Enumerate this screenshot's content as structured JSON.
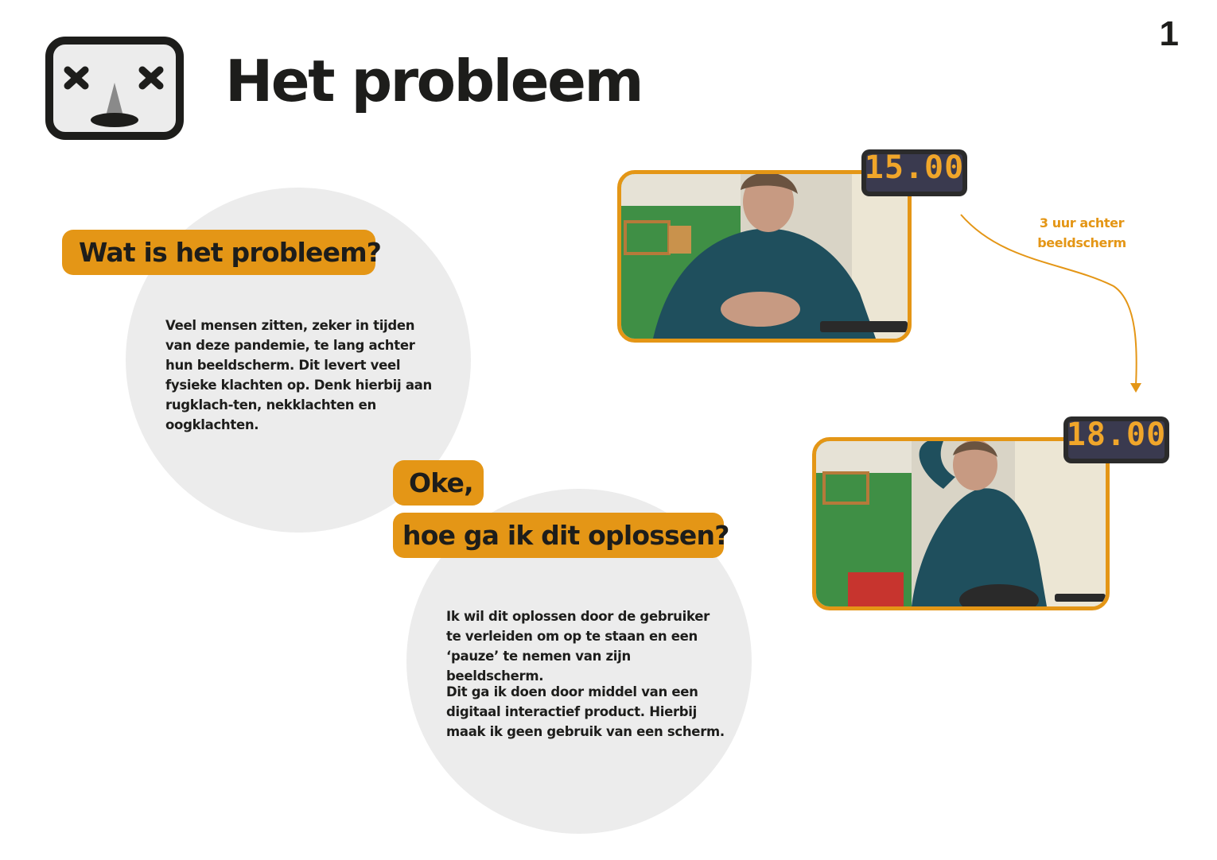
{
  "page": {
    "number": "1",
    "title": "Het probleem"
  },
  "section_problem": {
    "question": "Wat is het probleem?",
    "body": "Veel mensen zitten, zeker in tijden van deze pandemie, te lang achter hun beeldscherm. Dit levert veel fysieke klachten op. Denk hierbij aan rugklach-ten, nekklachten en oogklachten."
  },
  "section_solution": {
    "intro": "Oke,",
    "question": "hoe ga ik dit oplossen?",
    "body_1": "Ik wil dit oplossen door de gebruiker te verleiden om op te staan en een ‘pauze’ te nemen van zijn beeldscherm.",
    "body_2": "Dit ga ik doen door middel van een digitaal interactief product. Hierbij maak ik geen gebruik van een scherm."
  },
  "illustration": {
    "clock_before": "15.00",
    "clock_after": "18.00",
    "annotation": "3 uur achter beeldscherm"
  },
  "colors": {
    "accent": "#e49616",
    "circle": "#ececec",
    "text": "#1d1d1b"
  },
  "icons": [
    "dead-face-screen-icon",
    "arrow-curve-icon"
  ]
}
